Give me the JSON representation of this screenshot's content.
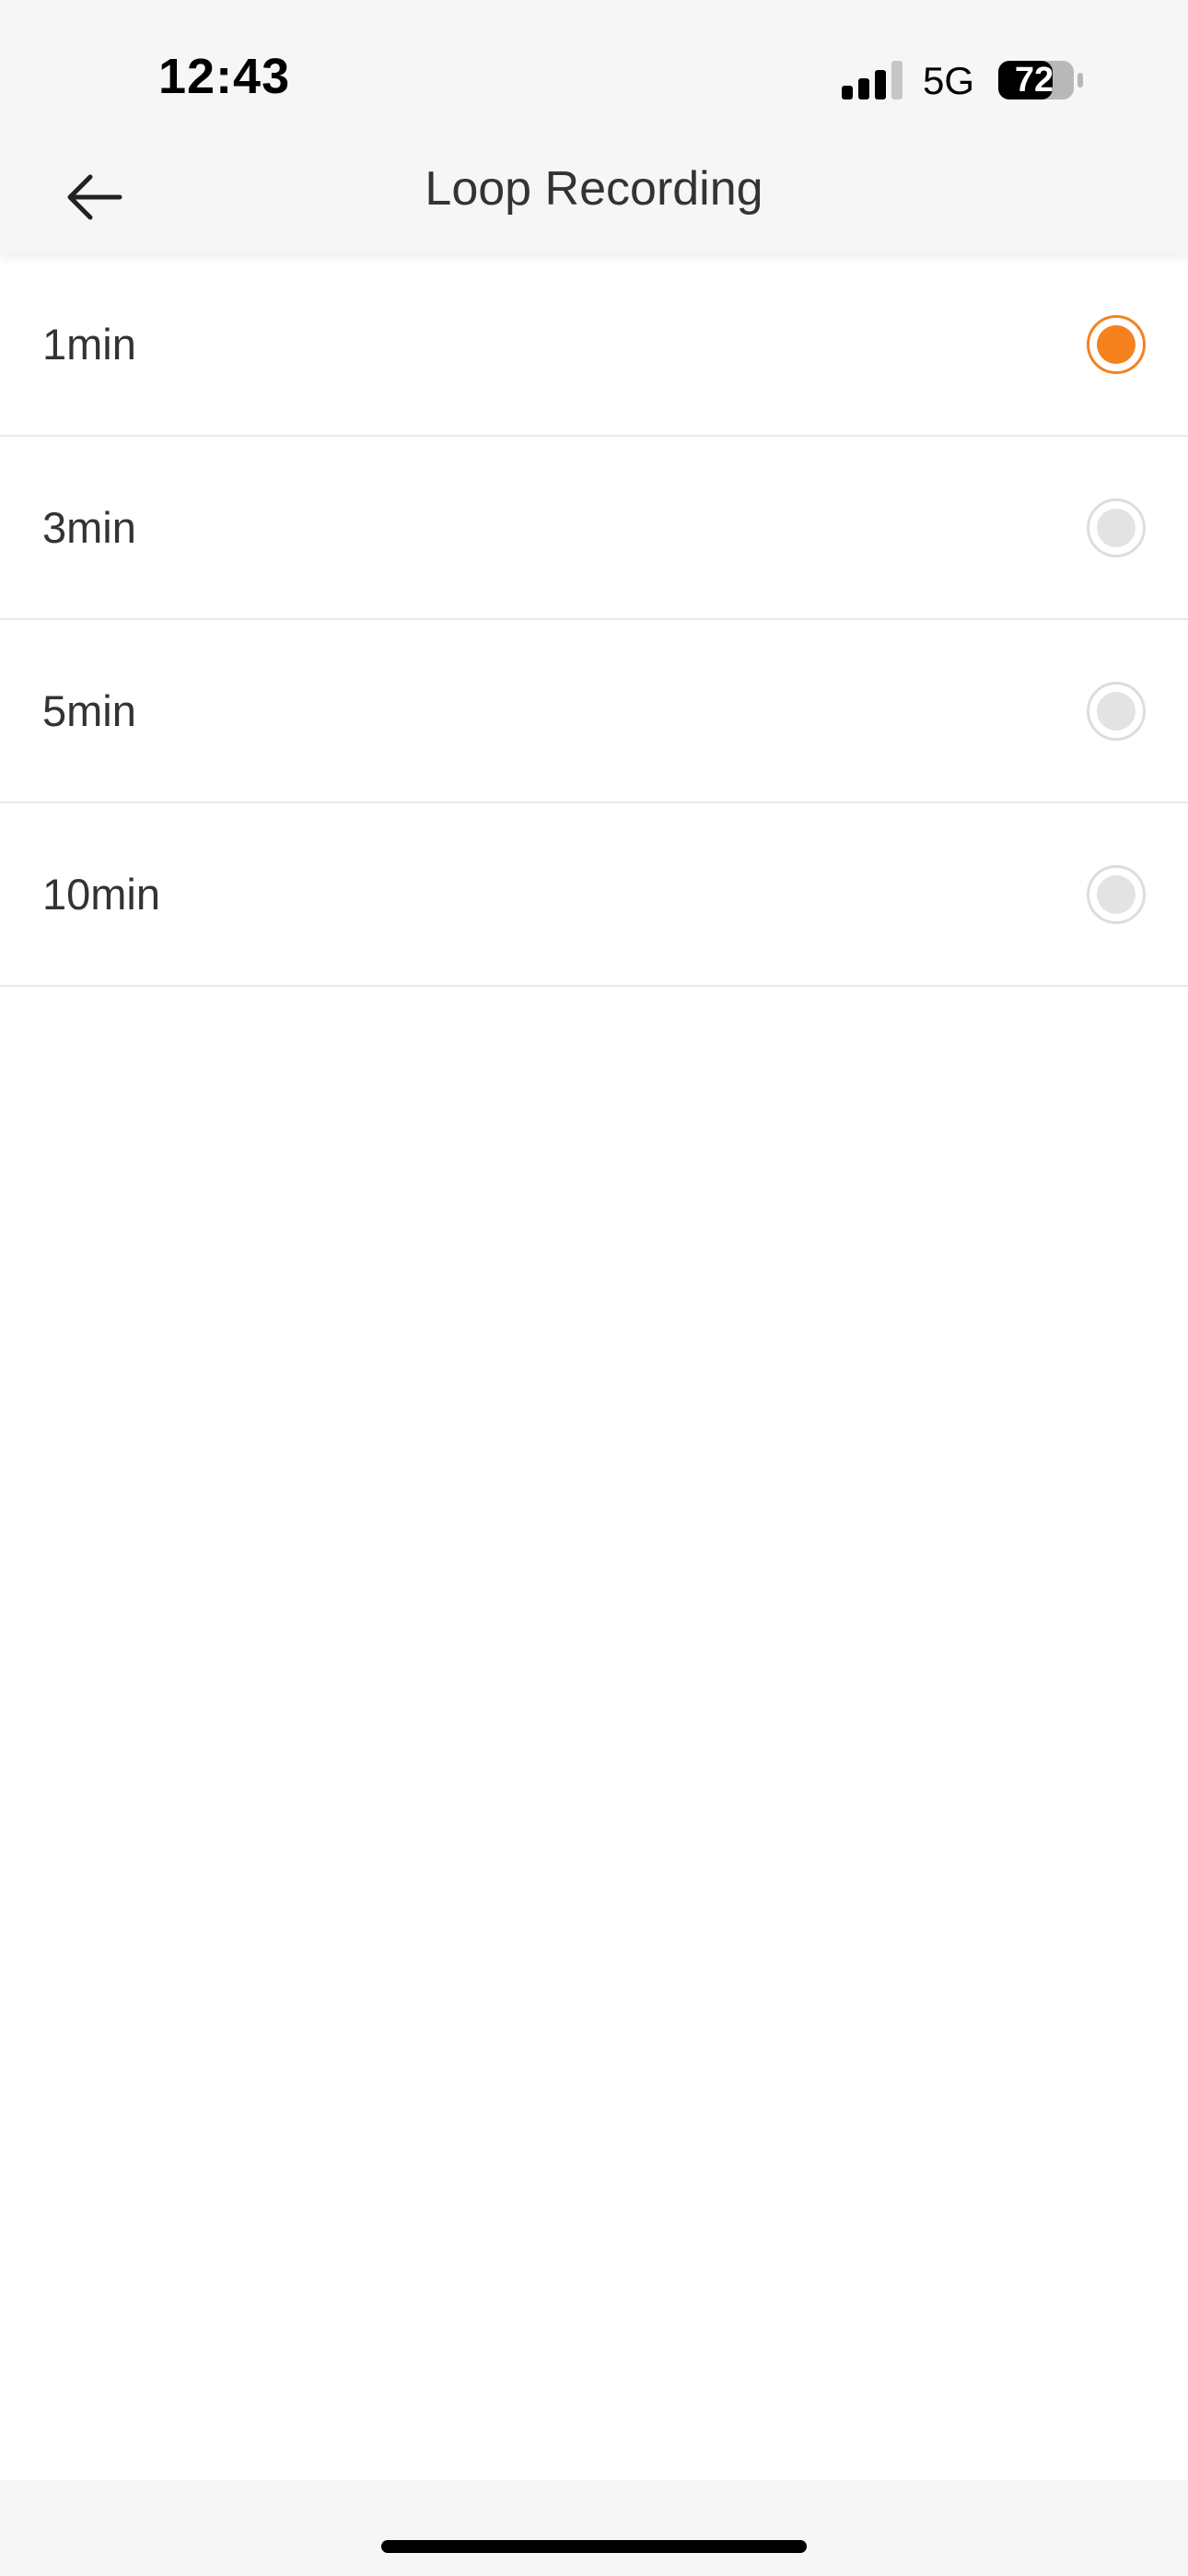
{
  "status_bar": {
    "time": "12:43",
    "network": "5G",
    "battery": "72",
    "battery_level": 0.72
  },
  "header": {
    "title": "Loop Recording",
    "back_icon": "arrow-left-icon"
  },
  "options": [
    {
      "label": "1min",
      "selected": true
    },
    {
      "label": "3min",
      "selected": false
    },
    {
      "label": "5min",
      "selected": false
    },
    {
      "label": "10min",
      "selected": false
    }
  ],
  "colors": {
    "accent": "#f5821f",
    "text": "#333333",
    "header_bg": "#f6f6f6",
    "divider": "#e8e8e8"
  }
}
